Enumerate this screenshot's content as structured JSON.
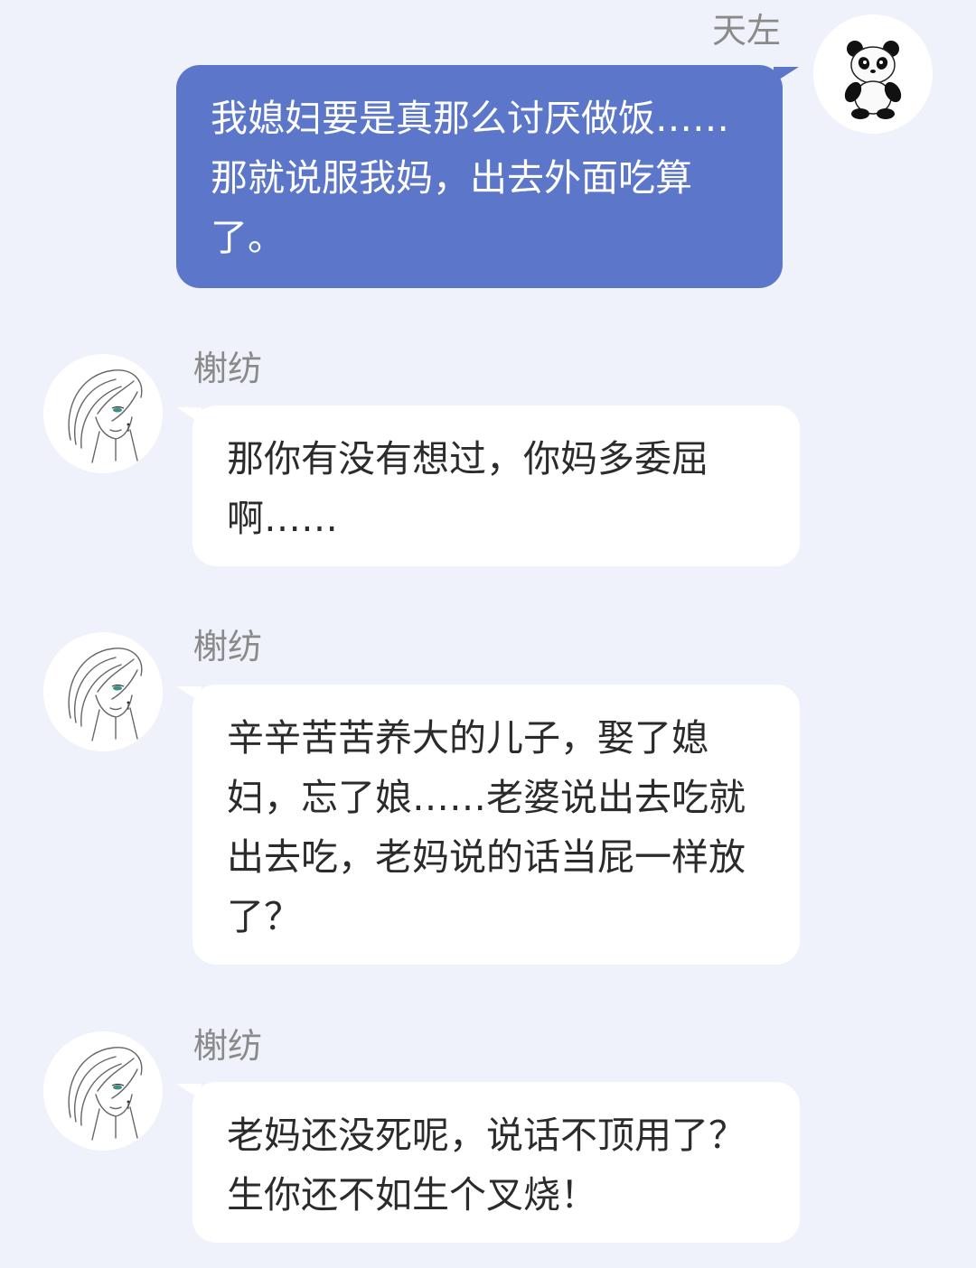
{
  "messages": [
    {
      "sender": "天左",
      "direction": "outgoing",
      "avatar": "panda-icon",
      "text": "我媳妇要是真那么讨厌做饭……那就说服我妈，出去外面吃算了。"
    },
    {
      "sender": "榭纺",
      "direction": "incoming",
      "avatar": "woman-sketch-icon",
      "text": "那你有没有想过，你妈多委屈啊……"
    },
    {
      "sender": "榭纺",
      "direction": "incoming",
      "avatar": "woman-sketch-icon",
      "text": "辛辛苦苦养大的儿子，娶了媳妇，忘了娘……老婆说出去吃就出去吃，老妈说的话当屁一样放了？"
    },
    {
      "sender": "榭纺",
      "direction": "incoming",
      "avatar": "woman-sketch-icon",
      "text": "老妈还没死呢，说话不顶用了？生你还不如生个叉烧！"
    }
  ],
  "colors": {
    "background": "#eff1fb",
    "outgoing_bubble": "#5c77c9",
    "incoming_bubble": "#ffffff",
    "name_text": "#8a8a8a",
    "message_text": "#2b2b2b"
  }
}
